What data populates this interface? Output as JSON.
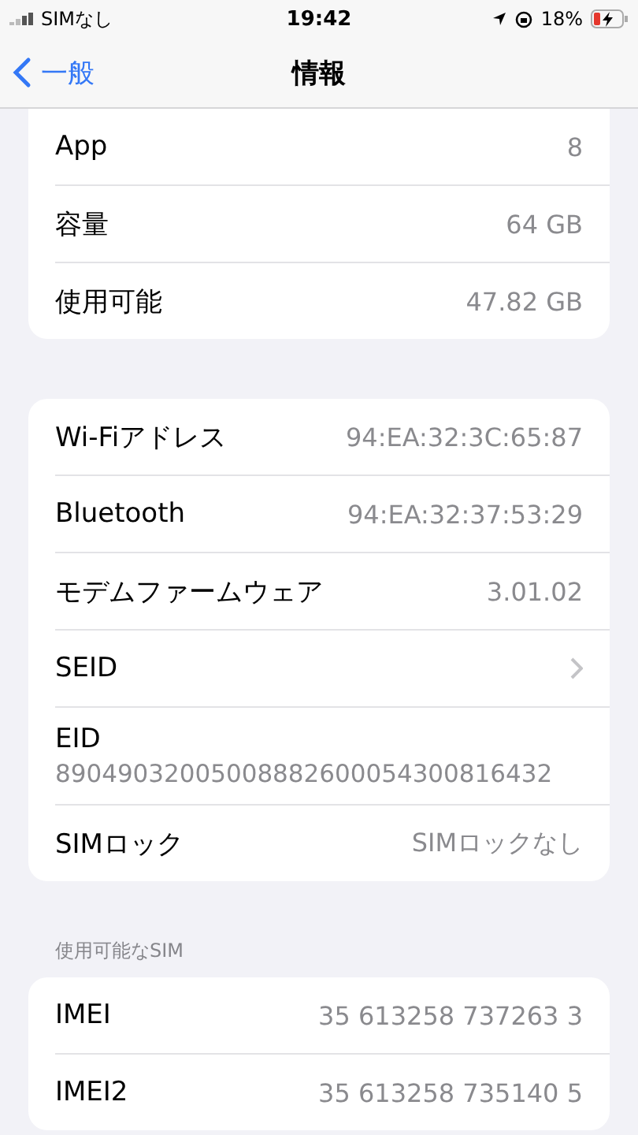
{
  "status_bar": {
    "carrier": "SIMなし",
    "time": "19:42",
    "battery": "18%"
  },
  "nav": {
    "back": "一般",
    "title": "情報"
  },
  "sections": [
    {
      "rows": [
        {
          "kind": "value",
          "label": "App",
          "value": "8"
        },
        {
          "kind": "value",
          "label": "容量",
          "value": "64 GB"
        },
        {
          "kind": "value",
          "label": "使用可能",
          "value": "47.82 GB"
        }
      ]
    },
    {
      "rows": [
        {
          "kind": "value",
          "label": "Wi-Fiアドレス",
          "value": "94:EA:32:3C:65:87"
        },
        {
          "kind": "value",
          "label": "Bluetooth",
          "value": "94:EA:32:37:53:29"
        },
        {
          "kind": "value",
          "label": "モデムファームウェア",
          "value": "3.01.02"
        },
        {
          "kind": "link",
          "label": "SEID"
        },
        {
          "kind": "stacked",
          "label": "EID",
          "value": "89049032005008882600054300816432"
        },
        {
          "kind": "value",
          "label": "SIMロック",
          "value": "SIMロックなし"
        }
      ]
    },
    {
      "header": "使用可能なSIM",
      "rows": [
        {
          "kind": "value",
          "label": "IMEI",
          "value": "35 613258 737263 3"
        },
        {
          "kind": "value",
          "label": "IMEI2",
          "value": "35 613258 735140 5"
        }
      ]
    }
  ]
}
